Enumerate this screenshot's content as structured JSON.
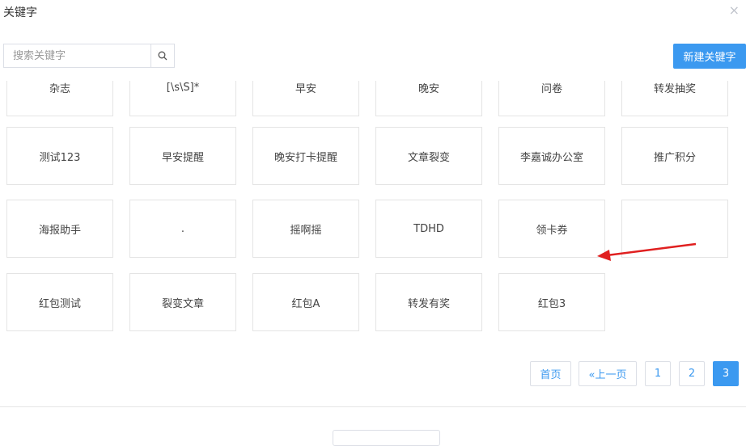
{
  "dialog": {
    "title": "关键字",
    "close_glyph": "×"
  },
  "search": {
    "placeholder": "搜索关键字",
    "icon": "search-icon"
  },
  "toolbar": {
    "new_label": "新建关键字"
  },
  "keywords": [
    [
      "杂志",
      "[\\s\\S]*",
      "早安",
      "晚安",
      "问卷",
      "转发抽奖"
    ],
    [
      "测试123",
      "早安提醒",
      "晚安打卡提醒",
      "文章裂变",
      "李嘉诚办公室",
      "推广积分"
    ],
    [
      "海报助手",
      ".",
      "摇啊摇",
      "TDHD",
      "领卡券",
      ""
    ],
    [
      "红包测试",
      "裂变文章",
      "红包A",
      "转发有奖",
      "红包3"
    ]
  ],
  "pagination": {
    "first": "首页",
    "prev": "«上一页",
    "pages": [
      "1",
      "2",
      "3"
    ],
    "current": "3"
  },
  "colors": {
    "accent": "#3b99f0",
    "annotation_arrow": "#e02020"
  }
}
